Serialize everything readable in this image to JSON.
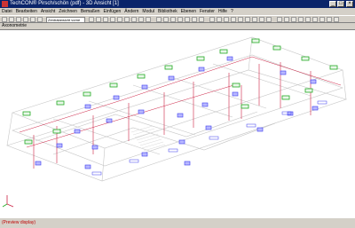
{
  "window": {
    "title": "TechCON® Pirsch/schön (pdf) - 3D Ansicht [1]"
  },
  "menu": [
    "Datei",
    "Bearbeiten",
    "Ansicht",
    "Zeichnen",
    "Bemaßen",
    "Einfügen",
    "Ändern",
    "Modul",
    "Bibliothek",
    "Ebenen",
    "Fenster",
    "Hilfe",
    "?"
  ],
  "toolbar": {
    "combo_value": "Zentralansicht vorne"
  },
  "view_label": "Axonometrie",
  "status_text": "(Preview display)",
  "colors": {
    "titlebar": "#0a246a",
    "canvas": "#ffffff",
    "frame_gray": "#c6c6c6",
    "pipe_red": "#cc2244",
    "fixture_green": "#22aa22",
    "symbol_blue": "#3a3aee"
  }
}
